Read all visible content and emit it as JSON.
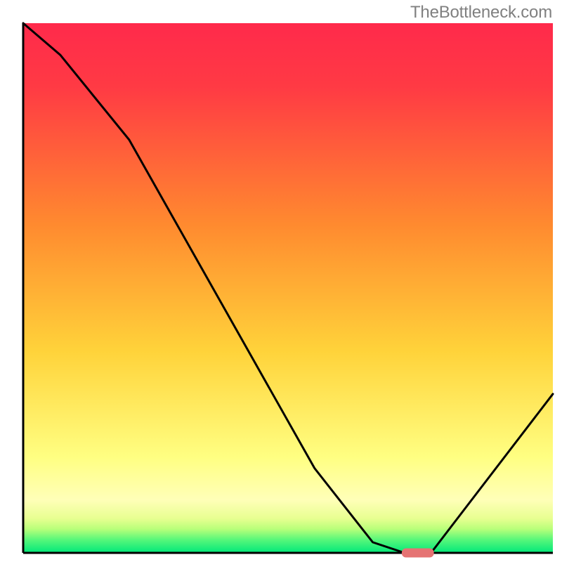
{
  "watermark": "TheBottleneck.com",
  "colors": {
    "red": "#ff2a4b",
    "orange": "#ff8a2f",
    "yellow_orange": "#ffd33a",
    "pale_yellow": "#ffff9a",
    "yellow_green": "#d9ff6a",
    "green": "#00e87a",
    "axis": "#000000",
    "curve": "#000000",
    "marker": "#e57373"
  },
  "chart_data": {
    "type": "line",
    "title": "",
    "xlabel": "",
    "ylabel": "",
    "xlim": [
      0,
      100
    ],
    "ylim": [
      0,
      100
    ],
    "x": [
      0,
      7,
      20,
      55,
      66,
      72,
      77,
      100
    ],
    "values": [
      100,
      94,
      78,
      16,
      2,
      0,
      0,
      30
    ],
    "marker": {
      "x_start": 72,
      "x_end": 77,
      "y": 0
    },
    "annotations": []
  }
}
